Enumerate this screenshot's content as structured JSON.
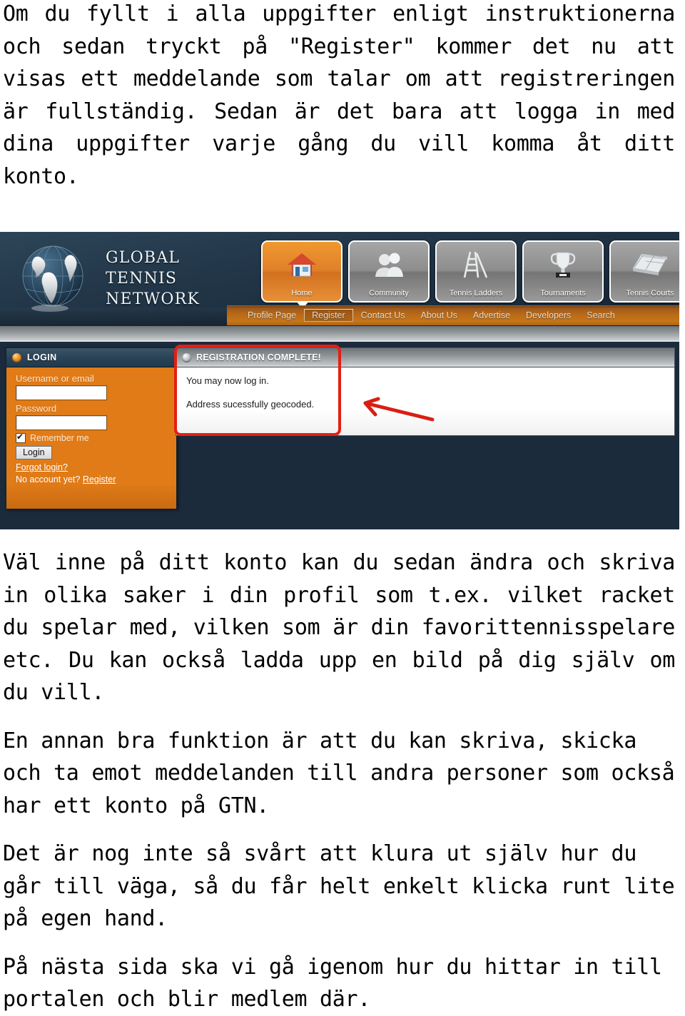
{
  "document": {
    "paragraphs_before": [
      "Om du fyllt i alla uppgifter enligt instruktionerna och sedan tryckt på \"Register\" kommer det nu att visas ett meddelande som talar om att registreringen är fullständig. Sedan är det bara att logga in med dina uppgifter varje gång du vill komma åt ditt konto."
    ],
    "paragraphs_after": [
      "Väl inne på ditt konto kan du sedan ändra och skriva in olika saker i din profil som t.ex. vilket racket du spelar med, vilken som är din favorittennisspelare etc. Du kan också ladda upp en bild på dig själv om du vill.",
      "En annan bra funktion är att du kan skriva, skicka och ta emot meddelanden till andra personer som också har ett konto på GTN.",
      "Det är nog inte så svårt att klura ut själv hur du går till väga, så du får helt enkelt klicka runt lite på egen hand.",
      "På nästa sida ska vi gå igenom hur du hittar in till portalen och blir medlem där."
    ]
  },
  "screenshot": {
    "brand": {
      "line1": "GLOBAL",
      "line2": "TENNIS",
      "line3": "NETWORK"
    },
    "nav_buttons": [
      {
        "label": "Home",
        "icon": "house-icon",
        "active": true
      },
      {
        "label": "Community",
        "icon": "people-icon",
        "active": false
      },
      {
        "label": "Tennis Ladders",
        "icon": "ladder-icon",
        "active": false
      },
      {
        "label": "Tournaments",
        "icon": "trophy-icon",
        "active": false
      },
      {
        "label": "Tennis Courts",
        "icon": "court-icon",
        "active": false
      }
    ],
    "subnav": [
      {
        "label": "Profile Page",
        "selected": false
      },
      {
        "label": "Register",
        "selected": true
      },
      {
        "label": "Contact Us",
        "selected": false
      },
      {
        "label": "About Us",
        "selected": false
      },
      {
        "label": "Advertise",
        "selected": false
      },
      {
        "label": "Developers",
        "selected": false
      },
      {
        "label": "Search",
        "selected": false
      }
    ],
    "login_panel": {
      "title": "LOGIN",
      "username_label": "Username or email",
      "username_value": "",
      "password_label": "Password",
      "password_value": "",
      "remember_label": "Remember me",
      "remember_checked": true,
      "login_button": "Login",
      "forgot_link": "Forgot login?",
      "no_account_text": "No account yet?",
      "register_link": "Register"
    },
    "registration_panel": {
      "title": "REGISTRATION COMPLETE!",
      "message_1": "You may now log in.",
      "message_2": "Address sucessfully geocoded."
    },
    "annotation": {
      "type": "red-arrow-pointing-left",
      "highlight": "red-rounded-rectangle"
    },
    "colors": {
      "header_navy": "#1b2b3c",
      "accent_orange": "#e07b18",
      "annotation_red": "#e41f12",
      "silver": "#8e9396"
    }
  }
}
